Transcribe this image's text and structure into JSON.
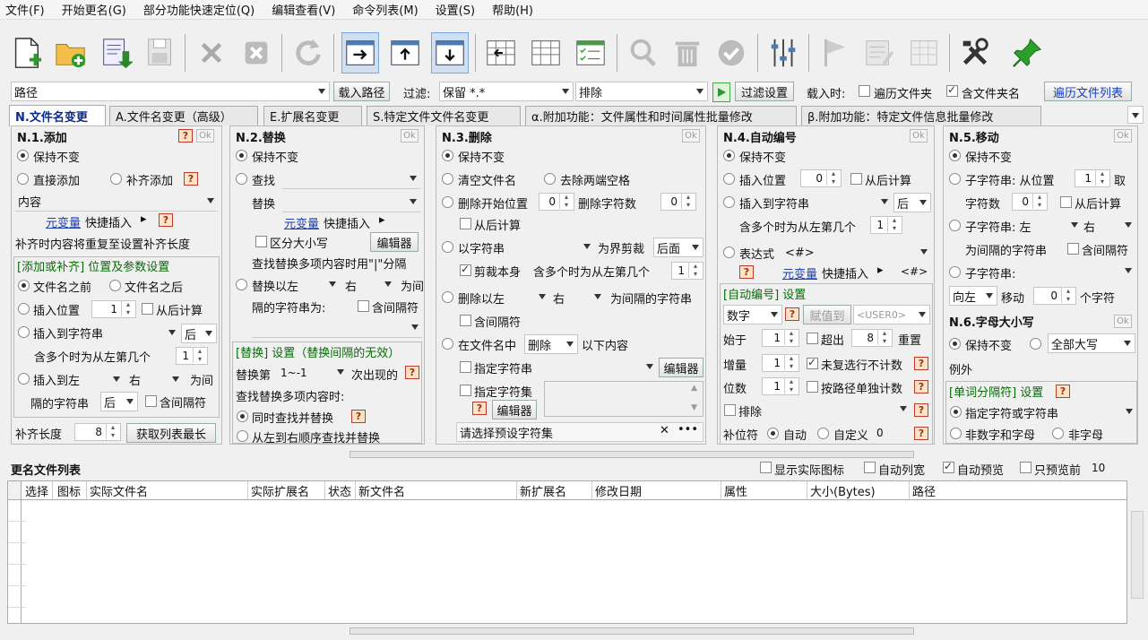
{
  "menu": {
    "file": "文件(F)",
    "start": "开始更名(G)",
    "locate": "部分功能快速定位(Q)",
    "edit": "编辑查看(V)",
    "cmds": "命令列表(M)",
    "settings": "设置(S)",
    "help": "帮助(H)"
  },
  "pathbar": {
    "path_label": "路径",
    "load_path": "载入路径",
    "filter_label": "过滤:",
    "filter_value": "保留 *.*",
    "exclude_value": "排除",
    "filter_settings": "过滤设置",
    "load_when": "载入时:",
    "traverse_folder": "遍历文件夹",
    "include_folder": "含文件夹名",
    "traverse_list": "遍历文件列表"
  },
  "tabs": [
    "N.文件名变更",
    "A.文件名变更（高级）",
    "E.扩展名变更",
    "S.特定文件文件名变更",
    "α.附加功能：文件属性和时间属性批量修改",
    "β.附加功能：特定文件信息批量修改"
  ],
  "common": {
    "keep": "保持不变",
    "ok": "Ok",
    "q": "?",
    "left": "左",
    "right": "右",
    "back": "后",
    "insert_pos": "插入位置",
    "from_back": "从后计算",
    "include_sep": "含间隔符",
    "multi_left": "含多个时为从左第几个",
    "sep_string": "隔的字符串为:",
    "for_sep": "为间",
    "for_sep2": "隔的字符串",
    "editor": "编辑器",
    "var_insert": "快捷插入",
    "var_link": "元变量"
  },
  "n1": {
    "title": "N.1.添加",
    "direct": "直接添加",
    "pad": "补齐添加",
    "content": "内容",
    "pad_hint": "补齐时内容将重复至设置补齐长度",
    "box_title": "[添加或补齐] 位置及参数设置",
    "before": "文件名之前",
    "after": "文件名之后",
    "insert_pos_val": "1",
    "insert_to": "插入到字符串",
    "multi_val": "1",
    "insert_to_left": "插入到左",
    "pad_len": "补齐长度",
    "pad_len_val": "8",
    "get_max": "获取列表最长"
  },
  "n2": {
    "title": "N.2.替换",
    "find": "查找",
    "replace": "替换",
    "case": "区分大小写",
    "multi_hint": "查找替换多项内容时用\"|\"分隔",
    "replace_left": "替换以左",
    "box_title": "[替换] 设置（替换间隔的无效）",
    "nth": "替换第",
    "nth_val": "1~-1",
    "nth_after": "次出现的",
    "multi_find": "查找替换多项内容时:",
    "simul": "同时查找并替换",
    "seq": "从左到右顺序查找并替换"
  },
  "n3": {
    "title": "N.3.删除",
    "clear": "清空文件名",
    "trim": "去除两端空格",
    "del_start": "删除开始位置",
    "del_start_val": "0",
    "del_count": "删除字符数",
    "del_count_val": "0",
    "from_back": "从后计算",
    "by_string": "以字符串",
    "boundary": "为界剪裁",
    "back_val": "后面",
    "cut_self": "剪裁本身",
    "multi_val": "1",
    "del_left": "删除以左",
    "for_sep_string": "为间隔的字符串",
    "in_name": "在文件名中",
    "delete_val": "删除",
    "below": "以下内容",
    "spec_str": "指定字符串",
    "spec_set": "指定字符集",
    "preset": "请选择预设字符集"
  },
  "n4": {
    "title": "N.4.自动编号",
    "insert_pos_val": "0",
    "insert_to": "插入到字符串",
    "multi_val": "1",
    "expr": "表达式",
    "expr_val": "<#>",
    "hash": "<#>",
    "box_title": "[自动编号] 设置",
    "number": "数字",
    "assign": "赋值到",
    "user": "<USER0>",
    "start": "始于",
    "start_val": "1",
    "overflow": "超出",
    "overflow_val": "8",
    "reset": "重置",
    "step": "增量",
    "step_val": "1",
    "skip_dup": "未复选行不计数",
    "digits": "位数",
    "digits_val": "1",
    "per_path": "按路径单独计数",
    "exclude": "排除",
    "pad_char": "补位符",
    "auto": "自动",
    "custom": "自定义",
    "custom_val": "0"
  },
  "n5": {
    "title": "N.5.移动",
    "substr_from": "子字符串: 从位置",
    "pos_val": "1",
    "take": "取",
    "count": "字符数",
    "count_val": "0",
    "from_back": "从后计算",
    "substr_left": "子字符串: 左",
    "as_sep": "为间隔的字符串",
    "substr": "子字符串:",
    "dir": "向左",
    "move": "移动",
    "move_val": "0",
    "chars": "个字符"
  },
  "n6": {
    "title": "N.6.字母大小写",
    "all_upper": "全部大写",
    "except": "例外",
    "box_title": "[单词分隔符] 设置",
    "spec": "指定字符或字符串",
    "nonalnum": "非数字和字母",
    "nonletter": "非字母"
  },
  "list": {
    "title": "更名文件列表",
    "show_icon": "显示实际图标",
    "auto_width": "自动列宽",
    "auto_preview": "自动预览",
    "preview_only": "只预览前",
    "preview_n": "10",
    "cols": [
      "选择",
      "图标",
      "实际文件名",
      "实际扩展名",
      "状态",
      "新文件名",
      "新扩展名",
      "修改日期",
      "属性",
      "大小(Bytes)",
      "路径"
    ]
  }
}
